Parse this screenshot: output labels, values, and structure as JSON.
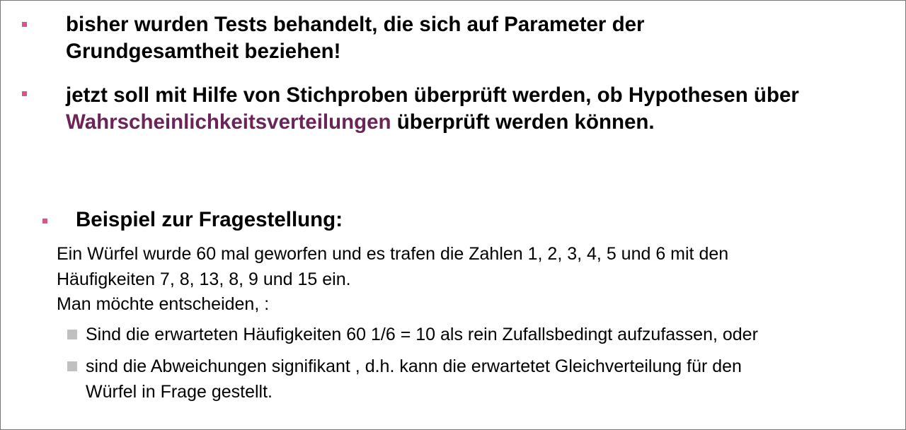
{
  "colors": {
    "bullet": "#e0508a",
    "highlight": "#6b2457",
    "sub_marker": "#c0c0c0",
    "text": "#000000"
  },
  "bullets": [
    {
      "lines": [
        "bisher wurden Tests behandelt, die sich auf Parameter der",
        "Grundgesamtheit beziehen!"
      ]
    },
    {
      "line1": "jetzt soll mit Hilfe von Stichproben überprüft werden,  ob Hypothesen über",
      "highlight": "Wahrscheinlichkeitsverteilungen",
      "line2_rest": " überprüft werden können."
    }
  ],
  "example": {
    "heading": "Beispiel zur Fragestellung:",
    "body_lines": [
      "Ein Würfel wurde 60 mal geworfen und es trafen die Zahlen 1, 2,  3, 4, 5 und 6 mit den",
      "Häufigkeiten 7, 8, 13, 8, 9 und 15 ein.",
      "Man möchte entscheiden, :"
    ],
    "sub_items": [
      {
        "lines": [
          "Sind die erwarteten Häufigkeiten 60  1/6 = 10 als rein Zufallsbedingt aufzufassen, oder"
        ]
      },
      {
        "lines": [
          "sind  die Abweichungen signifikant , d.h.  kann die erwartetet  Gleichverteilung für den",
          "Würfel  in Frage gestellt."
        ]
      }
    ]
  }
}
